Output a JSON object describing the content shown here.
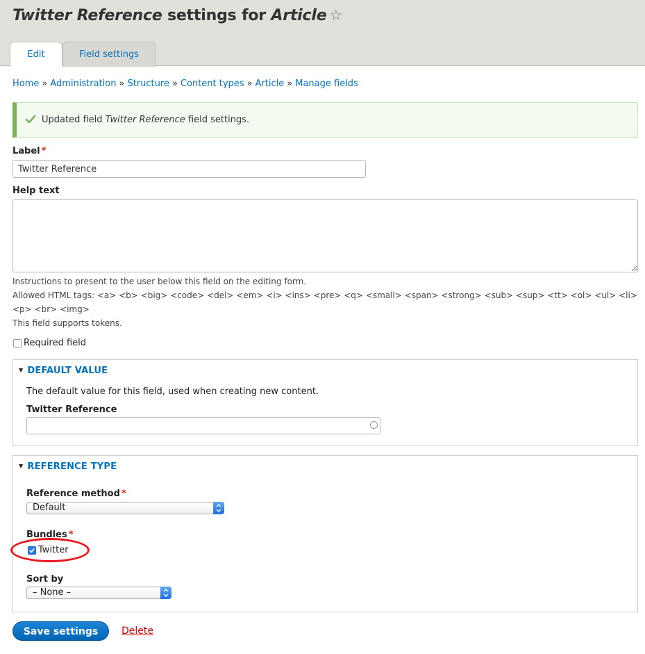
{
  "page_title": {
    "field_name": "Twitter Reference",
    "middle": " settings for ",
    "bundle": "Article",
    "star_glyph": "☆"
  },
  "tabs": [
    {
      "label": "Edit",
      "active": true
    },
    {
      "label": "Field settings",
      "active": false
    }
  ],
  "breadcrumb": {
    "separator": "»",
    "items": [
      "Home",
      "Administration",
      "Structure",
      "Content types",
      "Article",
      "Manage fields"
    ]
  },
  "status_message": {
    "prefix": "Updated field ",
    "field": "Twitter Reference",
    "suffix": " field settings."
  },
  "label_field": {
    "label": "Label",
    "required_mark": "*",
    "value": "Twitter Reference"
  },
  "help_text": {
    "label": "Help text",
    "value": "",
    "description_1": "Instructions to present to the user below this field on the editing form.",
    "description_2": "Allowed HTML tags: <a> <b> <big> <code> <del> <em> <i> <ins> <pre> <q> <small> <span> <strong> <sub> <sup> <tt> <ol> <ul> <li>",
    "description_3": "<p> <br> <img>",
    "description_4": "This field supports tokens."
  },
  "required_checkbox": {
    "label": "Required field",
    "checked": false
  },
  "default_value": {
    "legend": "Default value",
    "description": "The default value for this field, used when creating new content.",
    "field_label": "Twitter Reference",
    "field_value": ""
  },
  "reference_type": {
    "legend": "Reference type",
    "method_label": "Reference method",
    "method_required": "*",
    "method_value": "Default",
    "bundles_label": "Bundles",
    "bundles_required": "*",
    "bundle_option": "Twitter",
    "bundle_checked": true,
    "sort_label": "Sort by",
    "sort_value": "– None –"
  },
  "actions": {
    "save_label": "Save settings",
    "delete_label": "Delete"
  },
  "colors": {
    "link": "#0074bd",
    "header_bg": "#e1e0da",
    "success_accent": "#77b259",
    "required": "#e32700",
    "primary_button": "#0071c3",
    "delete": "#cc0000",
    "highlight": "#e8171f"
  }
}
